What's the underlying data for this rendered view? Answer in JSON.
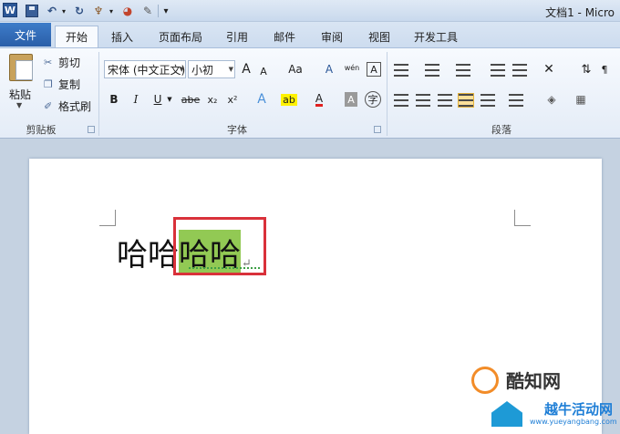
{
  "titlebar": {
    "app_logo": "W",
    "undo_glyph": "↶",
    "redo_glyph": "↻",
    "format_painter_glyph": "♆",
    "color_glyph": "◕",
    "customize_glyph": "▾",
    "title": "文档1 - Micro"
  },
  "tabs": {
    "file": "文件",
    "items": [
      "开始",
      "插入",
      "页面布局",
      "引用",
      "邮件",
      "审阅",
      "视图",
      "开发工具"
    ],
    "active_index": 0
  },
  "clipboard": {
    "paste": "粘贴",
    "cut": "剪切",
    "copy": "复制",
    "format_painter": "格式刷",
    "group_label": "剪贴板"
  },
  "font": {
    "font_name": "宋体 (中文正文)",
    "font_size": "小初",
    "grow": "A",
    "shrink": "A",
    "change_case": "Aa",
    "clear_format": "A",
    "pinyin": "wén",
    "border_char": "A",
    "bold": "B",
    "italic": "I",
    "underline": "U",
    "strike": "abe",
    "subscript": "x₂",
    "superscript": "x²",
    "text_effect": "A",
    "highlight": "ab",
    "font_color": "A",
    "shading": "A",
    "enclose": "字",
    "group_label": "字体"
  },
  "paragraph": {
    "group_label": "段落"
  },
  "document": {
    "text_before": "哈哈",
    "text_selected": "哈哈",
    "para_mark": "↵"
  },
  "watermark": {
    "brand": "酷知网",
    "sub": "越牛活动网",
    "url": "www.yueyangbang.com"
  },
  "colors": {
    "selection": "#92c954",
    "highlight_box": "#d9313a",
    "file_tab": "#2a5ea8"
  }
}
